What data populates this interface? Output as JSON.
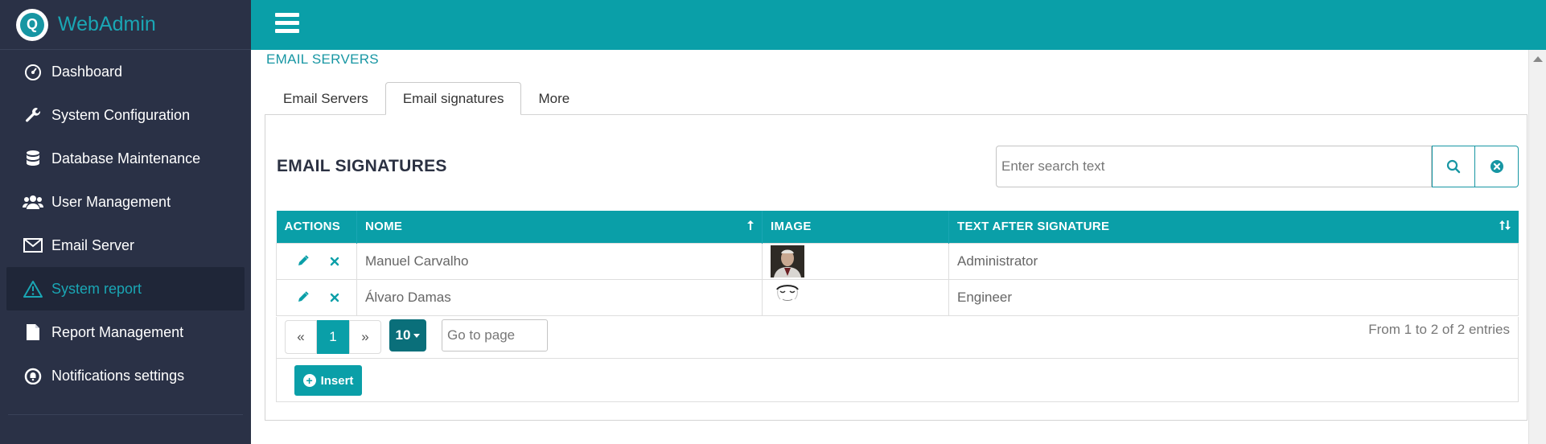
{
  "brand": {
    "logo_letter": "Q",
    "name": "WebAdmin"
  },
  "sidebar": {
    "items": [
      {
        "label": "Dashboard",
        "icon": "dashboard-gauge-icon"
      },
      {
        "label": "System Configuration",
        "icon": "wrench-icon"
      },
      {
        "label": "Database Maintenance",
        "icon": "database-icon"
      },
      {
        "label": "User Management",
        "icon": "users-icon"
      },
      {
        "label": "Email Server",
        "icon": "envelope-icon"
      },
      {
        "label": "System report",
        "icon": "warning-icon",
        "active": true
      },
      {
        "label": "Report Management",
        "icon": "document-icon"
      },
      {
        "label": "Notifications settings",
        "icon": "notification-bell-icon"
      }
    ]
  },
  "breadcrumb": "EMAIL SERVERS",
  "tabs": [
    {
      "label": "Email Servers"
    },
    {
      "label": "Email signatures",
      "active": true
    },
    {
      "label": "More"
    }
  ],
  "section": {
    "title": "EMAIL SIGNATURES"
  },
  "search": {
    "placeholder": "Enter search text"
  },
  "table": {
    "columns": [
      "ACTIONS",
      "NOME",
      "IMAGE",
      "TEXT AFTER SIGNATURE"
    ],
    "rows": [
      {
        "nome": "Manuel Carvalho",
        "image": "portrait-photo",
        "text": "Administrator"
      },
      {
        "nome": "Álvaro Damas",
        "image": "sketch-photo",
        "text": "Engineer"
      }
    ]
  },
  "pagination": {
    "prev": "«",
    "current": "1",
    "next": "»",
    "page_size": "10",
    "goto_placeholder": "Go to page",
    "entries_text": "From 1 to 2 of 2 entries"
  },
  "actions": {
    "insert_label": "Insert"
  },
  "colors": {
    "accent": "#0a9fa8",
    "sidebar_bg": "#2a3146",
    "brand_text": "#1aa6b4",
    "page_size_bg": "#0a6f7a"
  }
}
